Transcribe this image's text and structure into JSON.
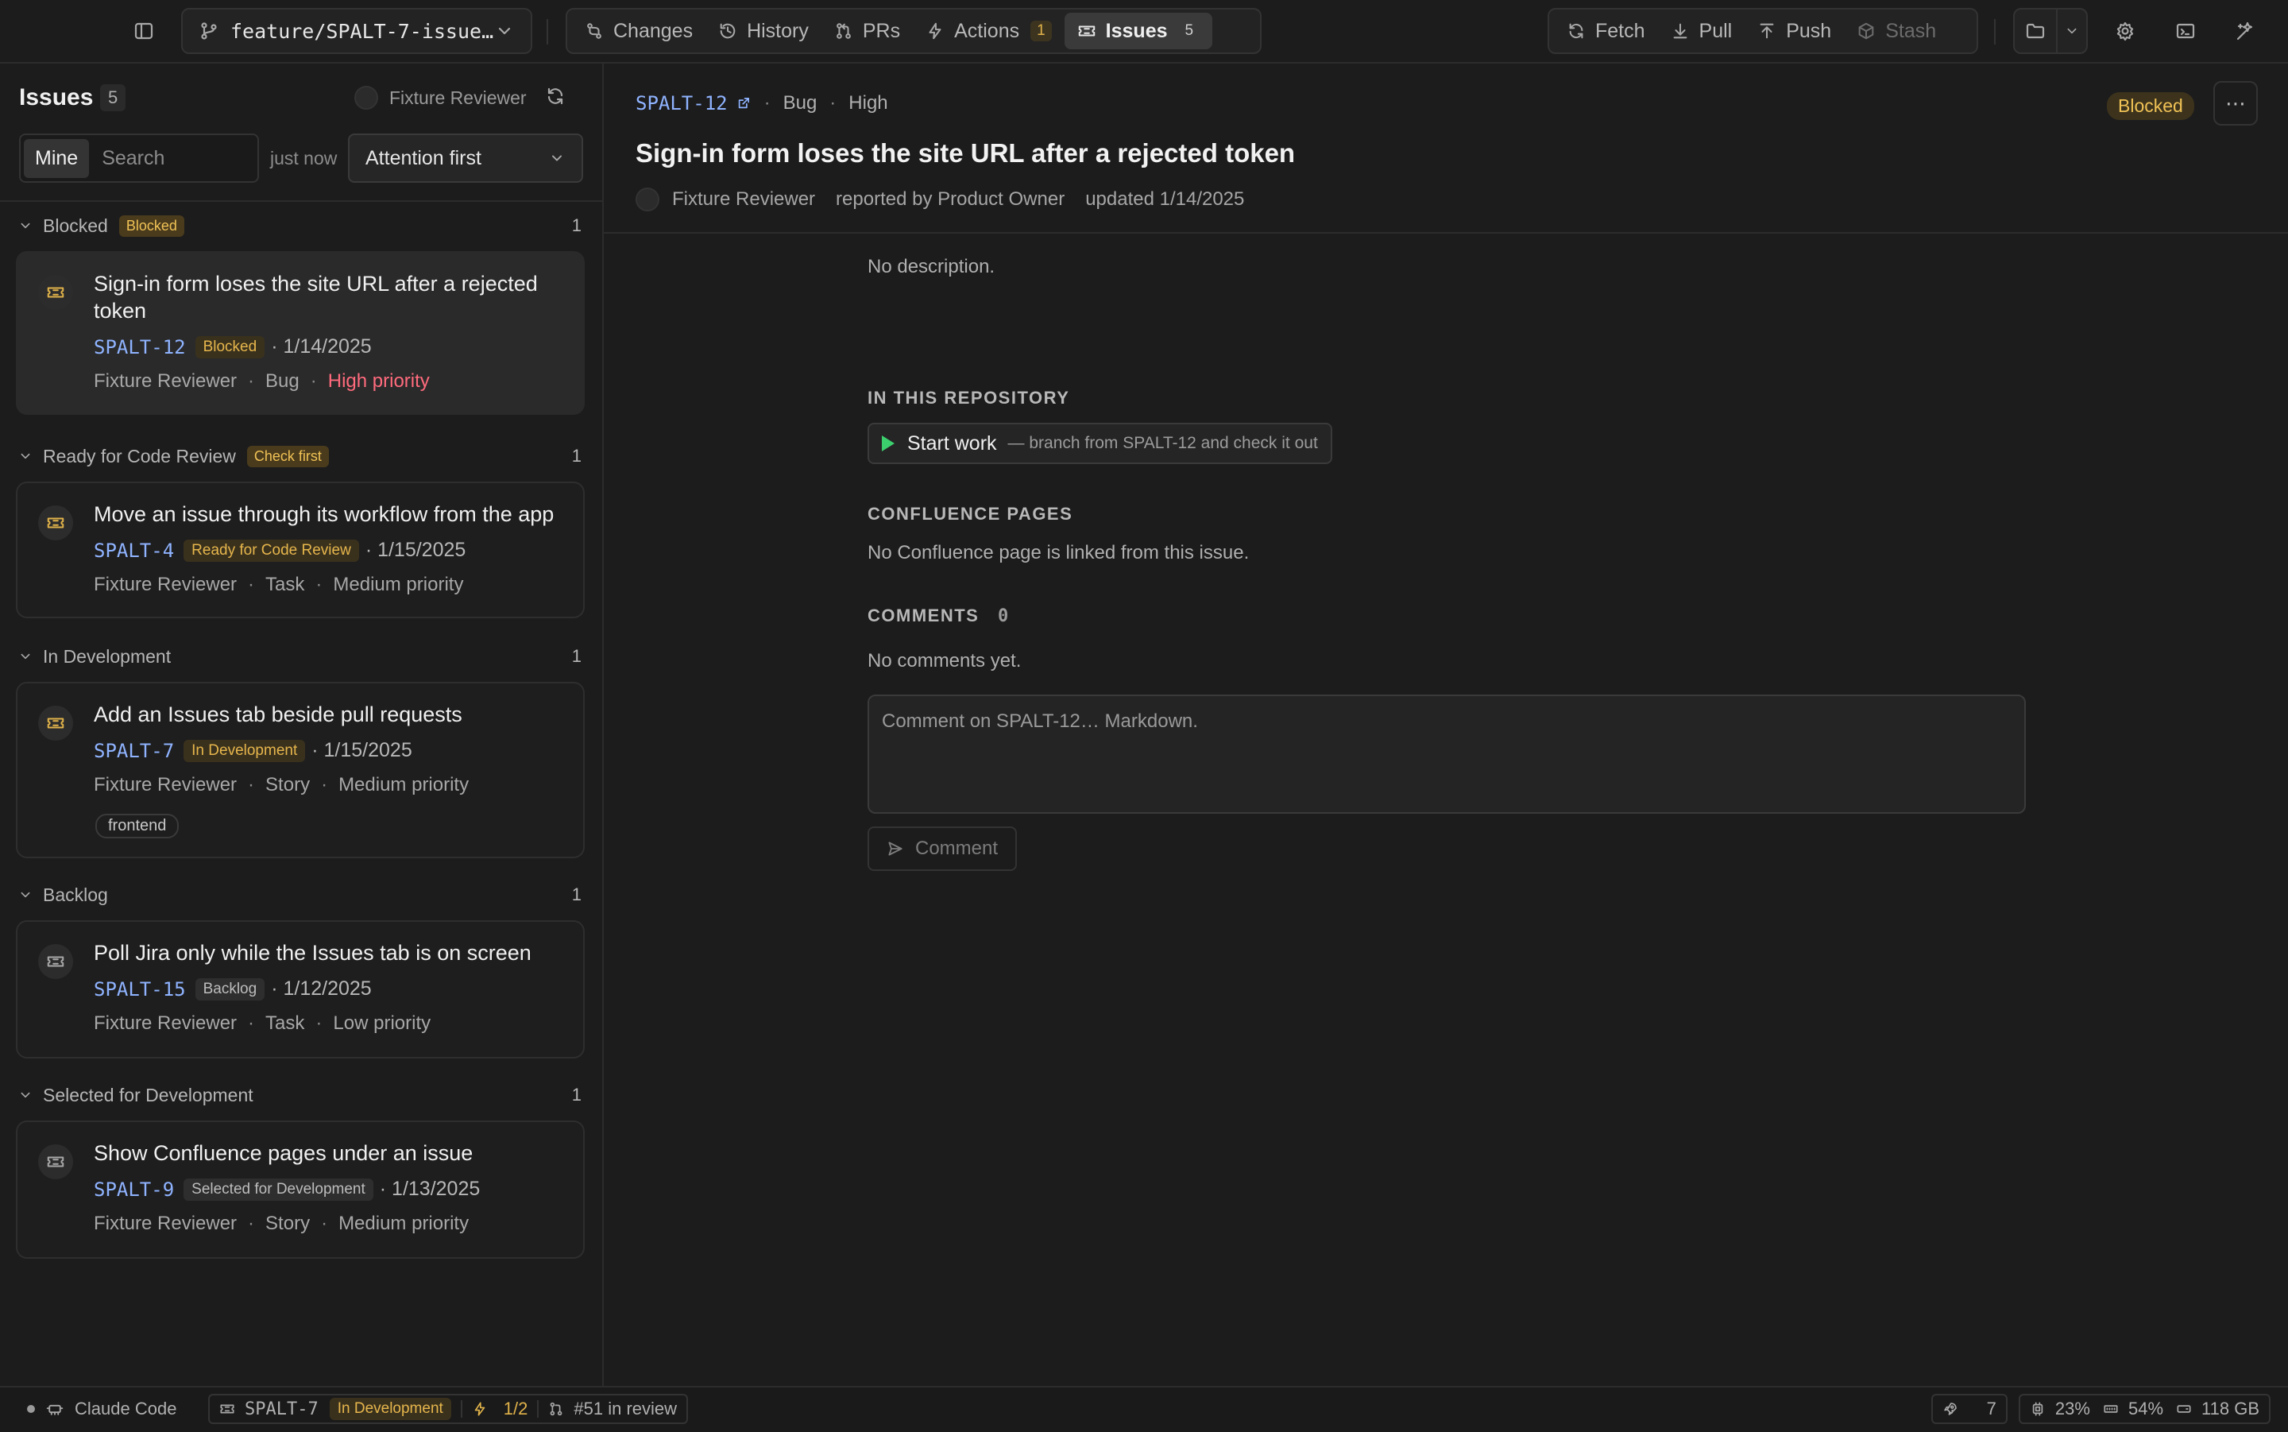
{
  "toolbar": {
    "branch": "feature/SPALT-7-issue…",
    "tabs": [
      {
        "label": "Changes",
        "count": ""
      },
      {
        "label": "History",
        "count": ""
      },
      {
        "label": "PRs",
        "count": ""
      },
      {
        "label": "Actions",
        "count": "1"
      },
      {
        "label": "Issues",
        "count": "5"
      }
    ],
    "remote": {
      "fetch": "Fetch",
      "pull": "Pull",
      "push": "Push",
      "stash": "Stash"
    }
  },
  "sidebar": {
    "title": "Issues",
    "count": "5",
    "reviewer": "Fixture Reviewer",
    "filter_mine": "Mine",
    "search_placeholder": "Search",
    "updated": "just now",
    "sort": "Attention first",
    "groups": [
      {
        "name": "Blocked",
        "badge": "Blocked",
        "count": "1",
        "cards": [
          {
            "title": "Sign-in form loses the site URL after a rejected token",
            "key": "SPALT-12",
            "status": "Blocked",
            "date": "· 1/14/2025",
            "reviewer": "Fixture Reviewer",
            "type": "Bug",
            "priority": "High priority",
            "tag": ""
          }
        ]
      },
      {
        "name": "Ready for Code Review",
        "badge": "Check first",
        "count": "1",
        "cards": [
          {
            "title": "Move an issue through its workflow from the app",
            "key": "SPALT-4",
            "status": "Ready for Code Review",
            "date": "· 1/15/2025",
            "reviewer": "Fixture Reviewer",
            "type": "Task",
            "priority": "Medium priority",
            "tag": ""
          }
        ]
      },
      {
        "name": "In Development",
        "badge": "",
        "count": "1",
        "cards": [
          {
            "title": "Add an Issues tab beside pull requests",
            "key": "SPALT-7",
            "status": "In Development",
            "date": "· 1/15/2025",
            "reviewer": "Fixture Reviewer",
            "type": "Story",
            "priority": "Medium priority",
            "tag": "frontend"
          }
        ]
      },
      {
        "name": "Backlog",
        "badge": "",
        "count": "1",
        "cards": [
          {
            "title": "Poll Jira only while the Issues tab is on screen",
            "key": "SPALT-15",
            "status": "Backlog",
            "date": "· 1/12/2025",
            "reviewer": "Fixture Reviewer",
            "type": "Task",
            "priority": "Low priority",
            "tag": ""
          }
        ]
      },
      {
        "name": "Selected for Development",
        "badge": "",
        "count": "1",
        "cards": [
          {
            "title": "Show Confluence pages under an issue",
            "key": "SPALT-9",
            "status": "Selected for Development",
            "date": "· 1/13/2025",
            "reviewer": "Fixture Reviewer",
            "type": "Story",
            "priority": "Medium priority",
            "tag": ""
          }
        ]
      }
    ]
  },
  "detail": {
    "key": "SPALT-12",
    "type": "Bug",
    "priority": "High",
    "status": "Blocked",
    "more": "⋯",
    "title": "Sign-in form loses the site URL after a rejected token",
    "assignee": "Fixture Reviewer",
    "reported_by": "reported by Product Owner",
    "updated": "updated 1/14/2025",
    "description": "No description.",
    "repo_heading": "IN THIS REPOSITORY",
    "start_work": "Start work",
    "start_work_hint": "— branch from SPALT-12 and check it out",
    "confluence_heading": "CONFLUENCE PAGES",
    "confluence_empty": "No Confluence page is linked from this issue.",
    "comments_heading": "COMMENTS",
    "comments_count": "0",
    "comments_empty": "No comments yet.",
    "comment_placeholder": "Comment on SPALT-12… Markdown.",
    "comment_button": "Comment"
  },
  "statusbar": {
    "agent": "Claude Code",
    "issue_key": "SPALT-7",
    "issue_status": "In Development",
    "checks": "1/2",
    "pr": "#51 in review",
    "notifications": "7",
    "cpu": "23%",
    "memory": "54%",
    "disk": "118 GB"
  },
  "colors": {
    "background": "#1c1c1c",
    "link": "#8fb3ff",
    "amber": "#f0c256",
    "high_priority": "#ff6b7d",
    "run": "#3ccf6e"
  }
}
